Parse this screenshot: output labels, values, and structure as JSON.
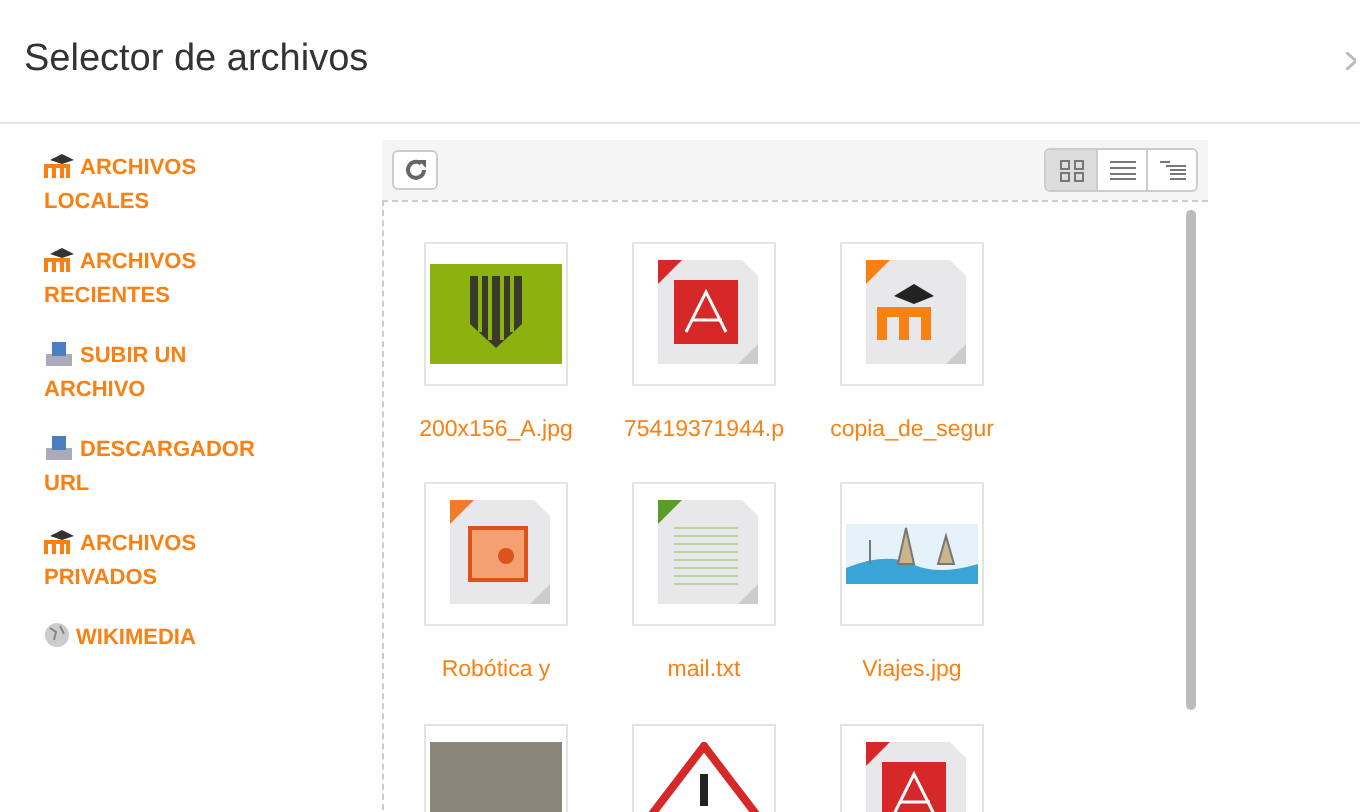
{
  "window": {
    "title": "Selector de archivos"
  },
  "sidebar": {
    "items": [
      {
        "label": "ARCHIVOS LOCALES",
        "kind": "moodle"
      },
      {
        "label": "ARCHIVOS RECIENTES",
        "kind": "moodle"
      },
      {
        "label": "SUBIR UN ARCHIVO",
        "kind": "upload"
      },
      {
        "label": "DESCARGADOR URL",
        "kind": "upload"
      },
      {
        "label": "ARCHIVOS PRIVADOS",
        "kind": "moodle"
      },
      {
        "label": "WIKIMEDIA",
        "kind": "globe"
      }
    ]
  },
  "toolbar": {
    "view_buttons": [
      {
        "kind": "icons",
        "selected": true
      },
      {
        "kind": "list",
        "selected": false
      },
      {
        "kind": "tree",
        "selected": false
      }
    ]
  },
  "files": [
    {
      "name": "200x156_A.jpg",
      "kind": "shield-image"
    },
    {
      "name": "75419371944.p",
      "kind": "pdf"
    },
    {
      "name": "copia_de_segur",
      "kind": "backup"
    },
    {
      "name": "Robótica y",
      "kind": "pptx"
    },
    {
      "name": "mail.txt",
      "kind": "text"
    },
    {
      "name": "Viajes.jpg",
      "kind": "landmarks-image"
    },
    {
      "kind": "photo"
    },
    {
      "kind": "warning"
    },
    {
      "kind": "pdf"
    }
  ]
}
